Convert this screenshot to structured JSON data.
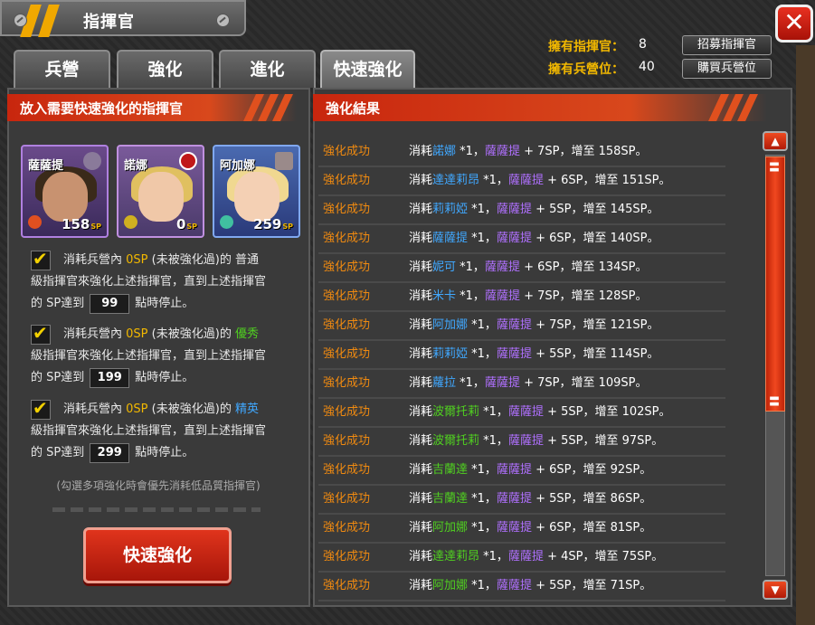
{
  "window": {
    "title": "指揮官",
    "close_label": "✕"
  },
  "tabs": [
    {
      "label": "兵營"
    },
    {
      "label": "強化"
    },
    {
      "label": "進化"
    },
    {
      "label": "快速強化",
      "active": true
    }
  ],
  "stats": {
    "commanders_label": "擁有指揮官：",
    "commanders_value": "8",
    "slots_label": "擁有兵營位：",
    "slots_value": "40",
    "recruit_button": "招募指揮官",
    "buy_slot_button": "購買兵營位"
  },
  "left_panel": {
    "header": "放入需要快速強化的指揮官",
    "cards": [
      {
        "name": "薩薩提",
        "sp": "158",
        "sp_unit": "SP"
      },
      {
        "name": "諾娜",
        "sp": "0",
        "sp_unit": "SP"
      },
      {
        "name": "阿加娜",
        "sp": "259",
        "sp_unit": "SP"
      }
    ],
    "options": [
      {
        "prefix": "消耗兵營內",
        "zero_sp": "0SP",
        "mid": "(未被強化過)的",
        "grade": "普通",
        "line2": "級指揮官來強化上述指揮官，直到上述指揮官",
        "sp_label": "的 SP達到",
        "value": "99",
        "suffix": "點時停止。"
      },
      {
        "prefix": "消耗兵營內",
        "zero_sp": "0SP",
        "mid": "(未被強化過)的",
        "grade": "優秀",
        "line2": "級指揮官來強化上述指揮官，直到上述指揮官",
        "sp_label": "的 SP達到",
        "value": "199",
        "suffix": "點時停止。"
      },
      {
        "prefix": "消耗兵營內",
        "zero_sp": "0SP",
        "mid": "(未被強化過)的",
        "grade": "精英",
        "line2": "級指揮官來強化上述指揮官，直到上述指揮官",
        "sp_label": "的 SP達到",
        "value": "299",
        "suffix": "點時停止。"
      }
    ],
    "note": "(勾選多項強化時會優先消耗低品質指揮官)",
    "quick_button": "快速強化"
  },
  "right_panel": {
    "header": "強化結果",
    "rows": [
      {
        "status": "強化成功",
        "consume": "消耗",
        "item": "諾娜",
        "item_color": "#40a8ff",
        "qty": " *1，",
        "target": "薩薩提",
        "gain": " + 7SP，增至 158SP。"
      },
      {
        "status": "強化成功",
        "consume": "消耗",
        "item": "達達莉昂",
        "item_color": "#40a8ff",
        "qty": " *1，",
        "target": "薩薩提",
        "gain": " + 6SP，增至 151SP。"
      },
      {
        "status": "強化成功",
        "consume": "消耗",
        "item": "莉莉婭",
        "item_color": "#40a8ff",
        "qty": " *1，",
        "target": "薩薩提",
        "gain": " + 5SP，增至 145SP。"
      },
      {
        "status": "強化成功",
        "consume": "消耗",
        "item": "薩薩提",
        "item_color": "#40a8ff",
        "qty": " *1，",
        "target": "薩薩提",
        "gain": " + 6SP，增至 140SP。"
      },
      {
        "status": "強化成功",
        "consume": "消耗",
        "item": "妮可",
        "item_color": "#40a8ff",
        "qty": " *1，",
        "target": "薩薩提",
        "gain": " + 6SP，增至 134SP。"
      },
      {
        "status": "強化成功",
        "consume": "消耗",
        "item": "米卡",
        "item_color": "#40a8ff",
        "qty": " *1，",
        "target": "薩薩提",
        "gain": " + 7SP，增至 128SP。"
      },
      {
        "status": "強化成功",
        "consume": "消耗",
        "item": "阿加娜",
        "item_color": "#40a8ff",
        "qty": " *1，",
        "target": "薩薩提",
        "gain": " + 7SP，增至 121SP。"
      },
      {
        "status": "強化成功",
        "consume": "消耗",
        "item": "莉莉婭",
        "item_color": "#40a8ff",
        "qty": " *1，",
        "target": "薩薩提",
        "gain": " + 5SP，增至 114SP。"
      },
      {
        "status": "強化成功",
        "consume": "消耗",
        "item": "蘿拉",
        "item_color": "#40a8ff",
        "qty": " *1，",
        "target": "薩薩提",
        "gain": " + 7SP，增至 109SP。"
      },
      {
        "status": "強化成功",
        "consume": "消耗",
        "item": "波爾托莉",
        "item_color": "#50d020",
        "qty": " *1，",
        "target": "薩薩提",
        "gain": " + 5SP，增至 102SP。"
      },
      {
        "status": "強化成功",
        "consume": "消耗",
        "item": "波爾托莉",
        "item_color": "#50d020",
        "qty": " *1，",
        "target": "薩薩提",
        "gain": " + 5SP，增至 97SP。"
      },
      {
        "status": "強化成功",
        "consume": "消耗",
        "item": "吉蘭達",
        "item_color": "#50d020",
        "qty": " *1，",
        "target": "薩薩提",
        "gain": " + 6SP，增至 92SP。"
      },
      {
        "status": "強化成功",
        "consume": "消耗",
        "item": "吉蘭達",
        "item_color": "#50d020",
        "qty": " *1，",
        "target": "薩薩提",
        "gain": " + 5SP，增至 86SP。"
      },
      {
        "status": "強化成功",
        "consume": "消耗",
        "item": "阿加娜",
        "item_color": "#50d020",
        "qty": " *1，",
        "target": "薩薩提",
        "gain": " + 6SP，增至 81SP。"
      },
      {
        "status": "強化成功",
        "consume": "消耗",
        "item": "達達莉昂",
        "item_color": "#50d020",
        "qty": " *1，",
        "target": "薩薩提",
        "gain": " + 4SP，增至 75SP。"
      },
      {
        "status": "強化成功",
        "consume": "消耗",
        "item": "阿加娜",
        "item_color": "#50d020",
        "qty": " *1，",
        "target": "薩薩提",
        "gain": " + 5SP，增至 71SP。"
      }
    ]
  },
  "colors": {
    "accent_orange": "#f08a10",
    "purple_name": "#b070ff",
    "gold": "#f2b800"
  }
}
